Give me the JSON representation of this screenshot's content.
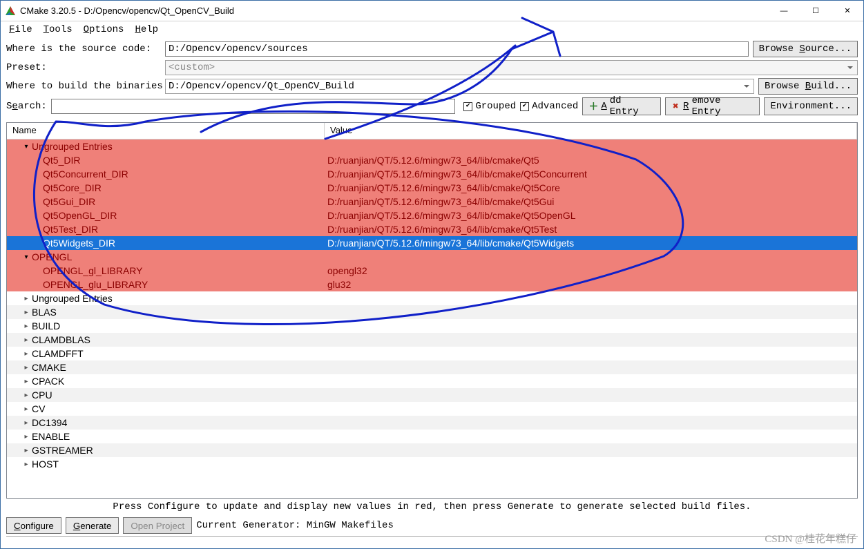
{
  "window": {
    "title": "CMake 3.20.5 - D:/Opencv/opencv/Qt_OpenCV_Build",
    "min": "—",
    "max": "☐",
    "close": "✕"
  },
  "menu": {
    "file": "File",
    "tools": "Tools",
    "options": "Options",
    "help": "Help"
  },
  "paths": {
    "src_label": "Where is the source code:",
    "src_value": "D:/Opencv/opencv/sources",
    "browse_src": "Browse Source...",
    "preset_label": "Preset:",
    "preset_value": "<custom>",
    "build_label": "Where to build the binaries:",
    "build_value": "D:/Opencv/opencv/Qt_OpenCV_Build",
    "browse_build": "Browse Build..."
  },
  "toolbar": {
    "search_label": "Search:",
    "grouped": "Grouped",
    "advanced": "Advanced",
    "add_entry": "Add Entry",
    "remove_entry": "Remove Entry",
    "environment": "Environment..."
  },
  "headers": {
    "name": "Name",
    "value": "Value"
  },
  "red_group1": {
    "title": "Ungrouped Entries",
    "rows": [
      {
        "n": "Qt5_DIR",
        "v": "D:/ruanjian/QT/5.12.6/mingw73_64/lib/cmake/Qt5"
      },
      {
        "n": "Qt5Concurrent_DIR",
        "v": "D:/ruanjian/QT/5.12.6/mingw73_64/lib/cmake/Qt5Concurrent"
      },
      {
        "n": "Qt5Core_DIR",
        "v": "D:/ruanjian/QT/5.12.6/mingw73_64/lib/cmake/Qt5Core"
      },
      {
        "n": "Qt5Gui_DIR",
        "v": "D:/ruanjian/QT/5.12.6/mingw73_64/lib/cmake/Qt5Gui"
      },
      {
        "n": "Qt5OpenGL_DIR",
        "v": "D:/ruanjian/QT/5.12.6/mingw73_64/lib/cmake/Qt5OpenGL"
      },
      {
        "n": "Qt5Test_DIR",
        "v": "D:/ruanjian/QT/5.12.6/mingw73_64/lib/cmake/Qt5Test"
      },
      {
        "n": "Qt5Widgets_DIR",
        "v": "D:/ruanjian/QT/5.12.6/mingw73_64/lib/cmake/Qt5Widgets",
        "sel": true
      }
    ]
  },
  "red_group2": {
    "title": "OPENGL",
    "rows": [
      {
        "n": "OPENGL_gl_LIBRARY",
        "v": "opengl32"
      },
      {
        "n": "OPENGL_glu_LIBRARY",
        "v": "glu32"
      }
    ]
  },
  "plain_groups": [
    "Ungrouped Entries",
    "BLAS",
    "BUILD",
    "CLAMDBLAS",
    "CLAMDFFT",
    "CMAKE",
    "CPACK",
    "CPU",
    "CV",
    "DC1394",
    "ENABLE",
    "GSTREAMER",
    "HOST"
  ],
  "hint": "Press Configure to update and display new values in red, then press Generate to generate selected build files.",
  "bottom": {
    "configure": "Configure",
    "generate": "Generate",
    "open_project": "Open Project",
    "gen_label": "Current Generator: MinGW Makefiles"
  },
  "output_peek": "",
  "watermark": "CSDN @桂花年糕仔"
}
